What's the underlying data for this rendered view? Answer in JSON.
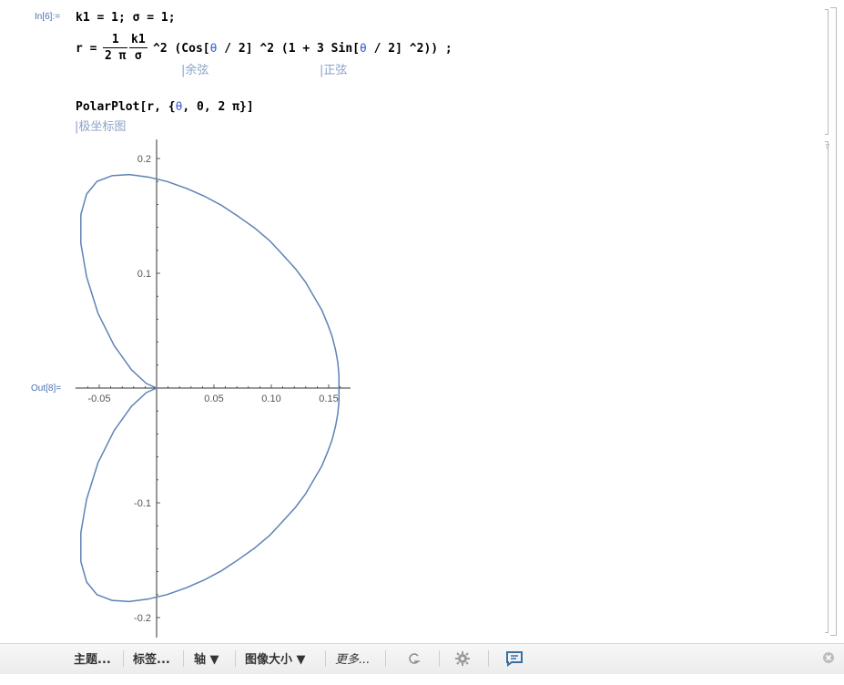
{
  "notebook": {
    "input_label": "In[6]:=",
    "output_label": "Out[8]=",
    "line1": "k1 = 1; σ = 1;",
    "line2": {
      "lhs": "r =",
      "frac1_num": "1",
      "frac1_den": "2 π",
      "frac2_num": "k1",
      "frac2_den": "σ",
      "power": "^2",
      "paren_open": "(Cos[",
      "theta1": "θ",
      "mid1": " / 2] ^2 (1 + 3 Sin[",
      "theta2": "θ",
      "tail": " / 2] ^2)) ;"
    },
    "hint_cos": "|余弦",
    "hint_sin": "|正弦",
    "line3_head": "PolarPlot[r, {",
    "line3_theta": "θ",
    "line3_tail": ", 0, 2 π}]",
    "hint_polar": "|极坐标图"
  },
  "chart_data": {
    "type": "line",
    "title": "",
    "xlabel": "",
    "ylabel": "",
    "description_formula": "r = (1/(2π)) (k1/σ)^2 (Cos[θ/2]^2 (1 + 3 Sin[θ/2]^2)), θ from 0 to 2π",
    "xlim": [
      -0.066,
      0.165
    ],
    "ylim": [
      -0.207,
      0.207
    ],
    "x_ticks": [
      -0.05,
      0.05,
      0.1,
      0.15
    ],
    "x_tick_labels": [
      "-0.05",
      "0.05",
      "0.10",
      "0.15"
    ],
    "y_ticks": [
      -0.2,
      -0.1,
      0.1,
      0.2
    ],
    "y_tick_labels": [
      "-0.2",
      "-0.1",
      "0.1",
      "0.2"
    ],
    "series": [
      {
        "color": "#5e81b5",
        "points": [
          [
            0.159,
            0
          ],
          [
            0.159,
            0.011
          ],
          [
            0.158,
            0.022
          ],
          [
            0.156,
            0.033
          ],
          [
            0.153,
            0.045
          ],
          [
            0.149,
            0.056
          ],
          [
            0.144,
            0.068
          ],
          [
            0.137,
            0.08
          ],
          [
            0.13,
            0.092
          ],
          [
            0.121,
            0.104
          ],
          [
            0.11,
            0.116
          ],
          [
            0.099,
            0.128
          ],
          [
            0.086,
            0.139
          ],
          [
            0.072,
            0.149
          ],
          [
            0.057,
            0.159
          ],
          [
            0.042,
            0.167
          ],
          [
            0.026,
            0.174
          ],
          [
            0.009,
            0.18
          ],
          [
            -0.008,
            0.184
          ],
          [
            -0.024,
            0.186
          ],
          [
            -0.039,
            0.185
          ],
          [
            -0.052,
            0.18
          ],
          [
            -0.061,
            0.169
          ],
          [
            -0.066,
            0.151
          ],
          [
            -0.066,
            0.126
          ],
          [
            -0.061,
            0.097
          ],
          [
            -0.051,
            0.065
          ],
          [
            -0.037,
            0.037
          ],
          [
            -0.022,
            0.016
          ],
          [
            -0.009,
            0.004
          ],
          [
            0,
            0
          ]
        ]
      }
    ]
  },
  "toolbar": {
    "theme": "主题...",
    "labels": "标签...",
    "axes": "轴 ▼",
    "image_size": "图像大小 ▼",
    "more": "更多...",
    "close_icon": "close-icon",
    "colors": {
      "bg": "#efefef",
      "text": "#333333"
    }
  }
}
